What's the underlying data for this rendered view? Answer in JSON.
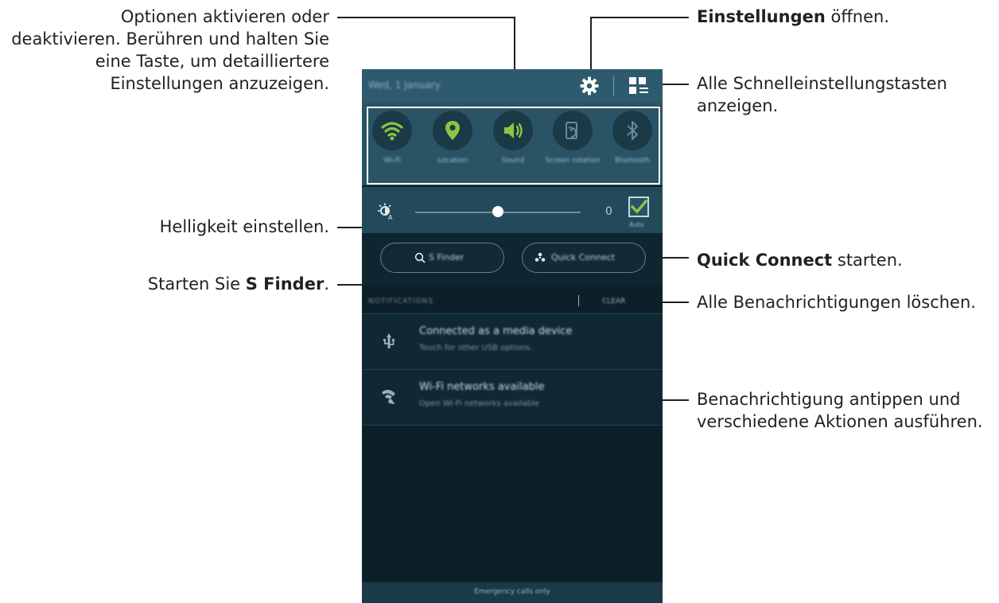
{
  "annotations": {
    "toggle_options": "Optionen aktivieren oder deaktivieren. Berühren und halten Sie eine Taste, um detailliertere Einstellungen anzuzeigen.",
    "toggle_options_lines": [
      "Optionen aktivieren oder",
      "deaktivieren. Berühren und halten Sie",
      "eine Taste, um detailliertere",
      "Einstellungen anzuzeigen."
    ],
    "settings_bold": "Einstellungen",
    "settings_rest": " öffnen.",
    "all_quick_lines": [
      "Alle Schnelleinstellungstasten",
      "anzeigen."
    ],
    "brightness": "Helligkeit einstellen.",
    "sfinder_pre": "Starten Sie ",
    "sfinder_bold": "S Finder",
    "sfinder_post": ".",
    "quick_connect_bold": "Quick Connect",
    "quick_connect_rest": " starten.",
    "clear_all": "Alle Benachrichtigungen löschen.",
    "notification_lines": [
      "Benachrichtigung antippen und",
      "verschiedene Aktionen ausführen."
    ]
  },
  "phone": {
    "date": "Wed, 1 January",
    "quick_settings": [
      {
        "label": "Wi-Fi",
        "icon": "wifi-icon",
        "active": true
      },
      {
        "label": "Location",
        "icon": "location-icon",
        "active": true
      },
      {
        "label": "Sound",
        "icon": "sound-icon",
        "active": true
      },
      {
        "label": "Screen rotation",
        "icon": "screen-rotation-icon",
        "active": false
      },
      {
        "label": "Bluetooth",
        "icon": "bluetooth-icon",
        "active": false
      }
    ],
    "brightness_value": "0",
    "auto_label": "Auto",
    "auto_checked": true,
    "s_finder_label": "S Finder",
    "quick_connect_label": "Quick Connect",
    "notifications_header": "NOTIFICATIONS",
    "clear_label": "CLEAR",
    "notifications": [
      {
        "title": "Connected as a media device",
        "subtitle": "Touch for other USB options.",
        "icon": "usb-icon"
      },
      {
        "title": "Wi-Fi networks available",
        "subtitle": "Open Wi-Fi networks available",
        "icon": "wifi-notification-icon"
      }
    ],
    "emergency": "Emergency calls only"
  },
  "colors": {
    "active_toggle": "#8cc63f",
    "inactive_toggle": "#6b8a96",
    "panel_top": "#2e5a6e",
    "panel_bg": "#0d2029"
  }
}
